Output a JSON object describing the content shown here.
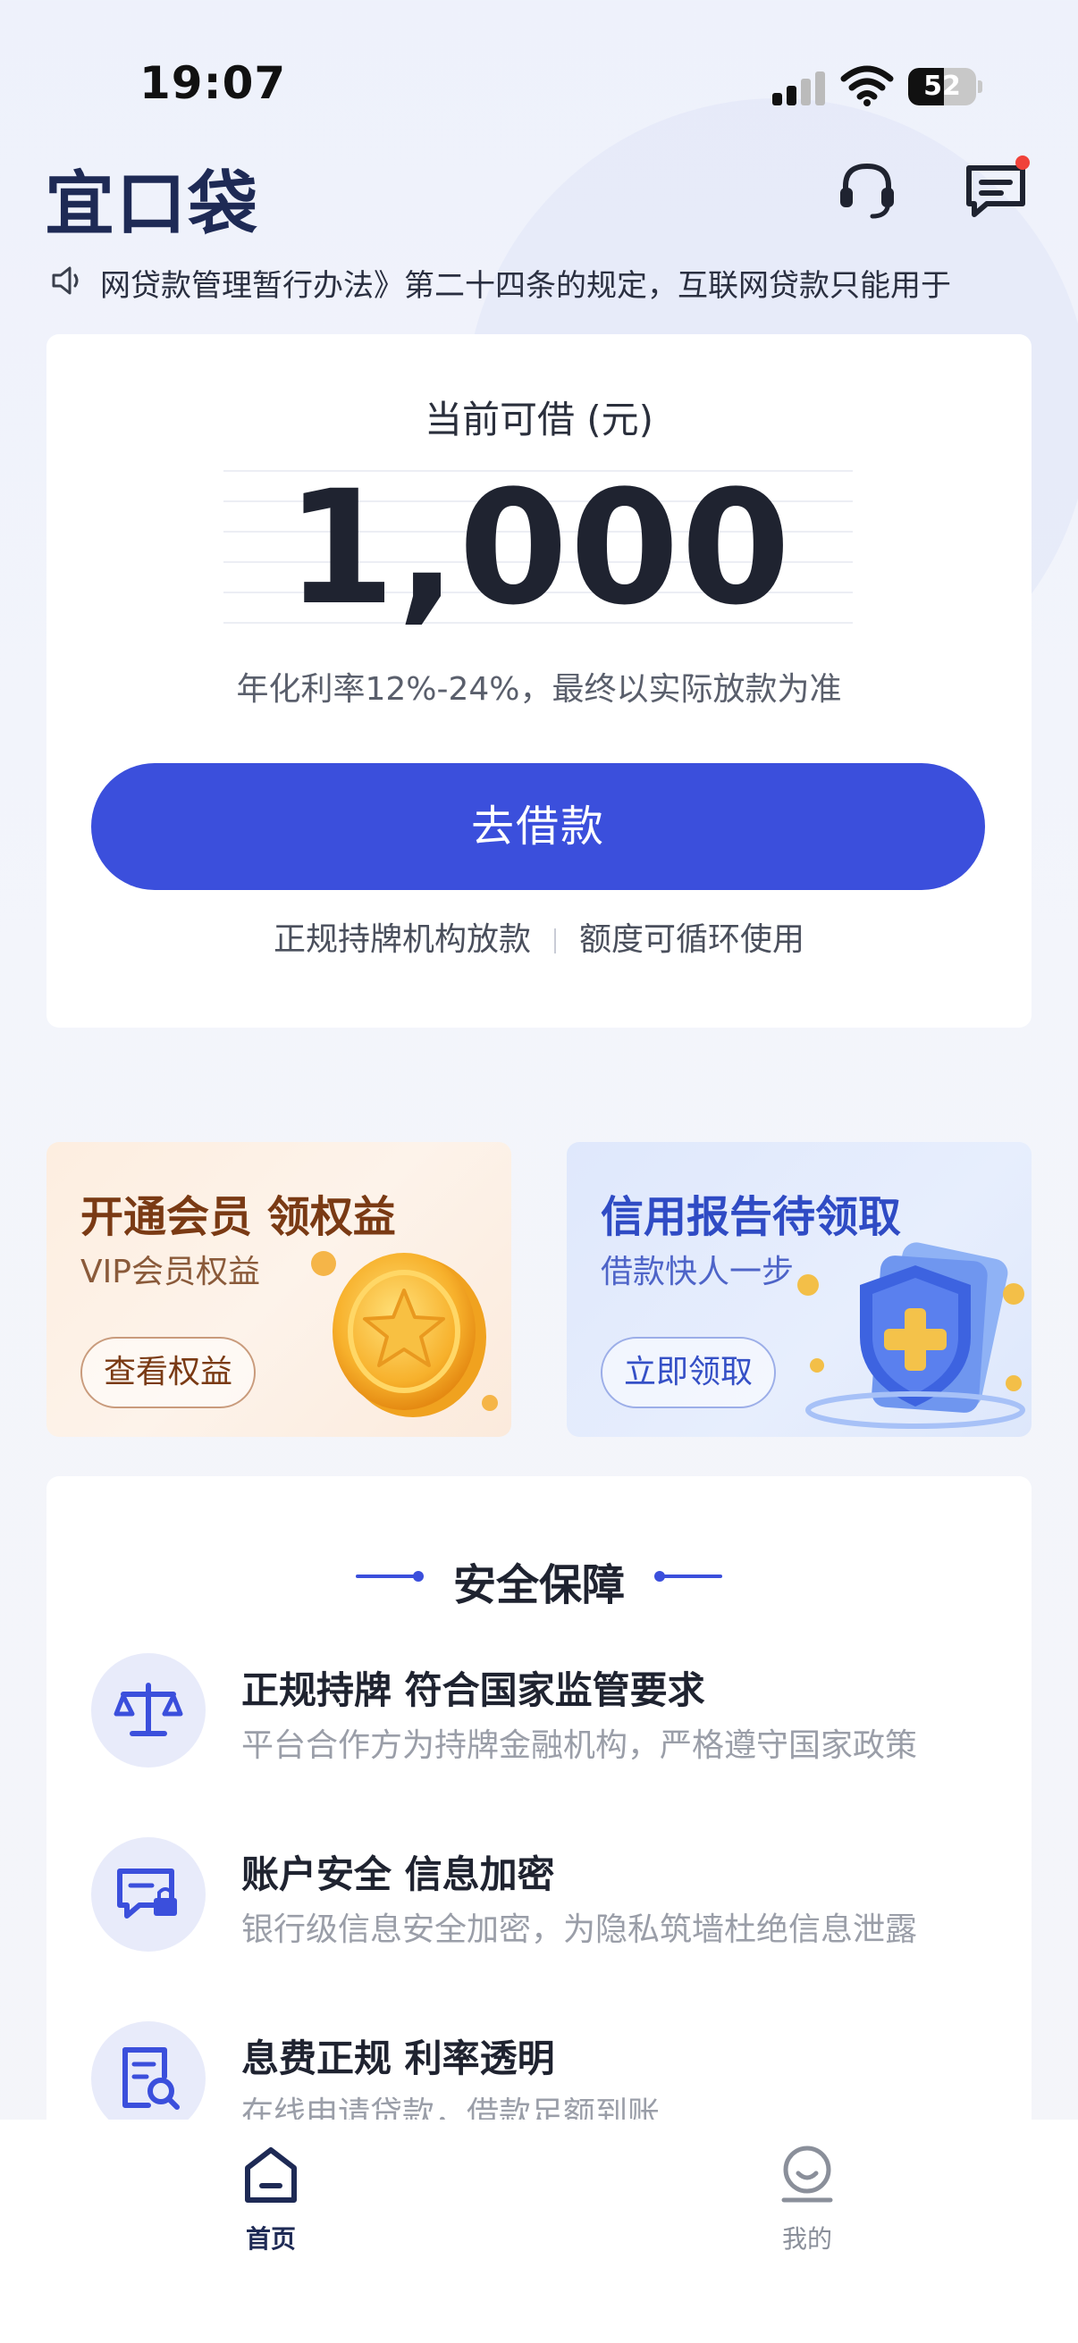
{
  "status": {
    "time": "19:07",
    "battery": "52",
    "battery_level": 0.52
  },
  "header": {
    "logo": "宜口袋",
    "icons": [
      "headset-icon",
      "message-icon"
    ]
  },
  "notice": {
    "text": "网贷款管理暂行办法》第二十四条的规定，互联网贷款只能用于"
  },
  "borrow": {
    "label": "当前可借 (元)",
    "amount": "1,000",
    "rate_note": "年化利率12%-24%，最终以实际放款为准",
    "button": "去借款",
    "feature_1": "正规持牌机构放款",
    "feature_2": "额度可循环使用"
  },
  "promos": [
    {
      "title": "开通会员 领权益",
      "subtitle": "VIP会员权益",
      "button": "查看权益",
      "icon": "gold-coin-icon"
    },
    {
      "title": "信用报告待领取",
      "subtitle": "借款快人一步",
      "button": "立即领取",
      "icon": "shield-icon"
    }
  ],
  "security": {
    "title": "安全保障",
    "items": [
      {
        "title": "正规持牌 符合国家监管要求",
        "desc": "平台合作方为持牌金融机构，严格遵守国家政策",
        "icon": "scale-icon"
      },
      {
        "title": "账户安全 信息加密",
        "desc": "银行级信息安全加密，为隐私筑墙杜绝信息泄露",
        "icon": "lock-card-icon"
      },
      {
        "title": "息费正规  利率透明",
        "desc": "在线申请贷款，借款足额到账",
        "icon": "document-search-icon"
      }
    ]
  },
  "tabbar": {
    "home": "首页",
    "mine": "我的",
    "active_color": "#1e2a55",
    "inactive_color": "#8a8f9a"
  },
  "colors": {
    "primary": "#3b4fdc",
    "logo": "#1e2a55"
  }
}
